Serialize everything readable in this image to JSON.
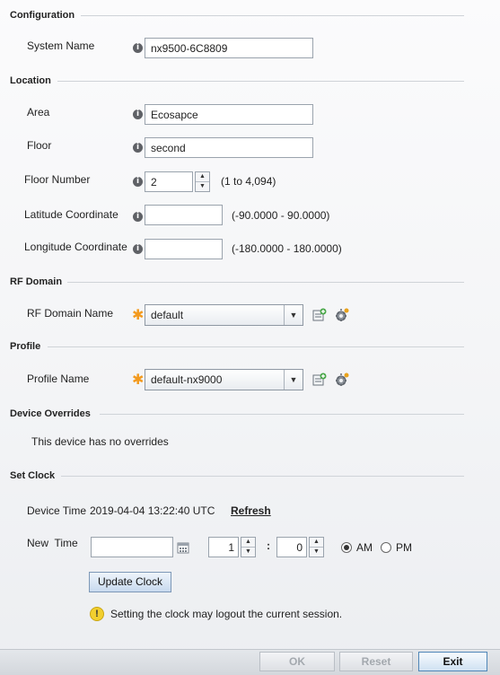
{
  "configuration": {
    "title": "Configuration",
    "system_name_label": "System Name",
    "system_name_value": "nx9500-6C8809"
  },
  "location": {
    "title": "Location",
    "area_label": "Area",
    "area_value": "Ecosapce",
    "floor_label": "Floor",
    "floor_value": "second",
    "floor_number_label": "Floor Number",
    "floor_number_value": "2",
    "floor_number_hint": "(1 to 4,094)",
    "latitude_label": "Latitude Coordinate",
    "latitude_value": "",
    "latitude_hint": "(-90.0000 - 90.0000)",
    "longitude_label": "Longitude Coordinate",
    "longitude_value": "",
    "longitude_hint": "(-180.0000 - 180.0000)"
  },
  "rf_domain": {
    "title": "RF Domain",
    "name_label": "RF Domain Name",
    "selected": "default"
  },
  "profile": {
    "title": "Profile",
    "name_label": "Profile Name",
    "selected": "default-nx9000"
  },
  "device_overrides": {
    "title": "Device Overrides",
    "message": "This device has no overrides"
  },
  "set_clock": {
    "title": "Set Clock",
    "device_time_label": "Device Time",
    "device_time_value": "2019-04-04 13:22:40 UTC",
    "refresh_label": "Refresh",
    "new_time_label": "New  Time",
    "date_value": "",
    "hour_value": "1",
    "separator": ":",
    "minute_value": "0",
    "am_label": "AM",
    "pm_label": "PM",
    "am_selected": true,
    "update_label": "Update Clock",
    "warning_text": "Setting the clock may logout the current session."
  },
  "footer": {
    "ok_label": "OK",
    "reset_label": "Reset",
    "exit_label": "Exit"
  },
  "icons": {
    "info": "info-icon",
    "required": "required-star-icon",
    "create": "create-new-icon",
    "edit": "gear-edit-icon",
    "calendar": "calendar-icon",
    "warning": "warning-icon"
  },
  "colors": {
    "required_star": "#f39a1e",
    "exit_border": "#4f86b7",
    "warning": "#f2cf2f"
  }
}
